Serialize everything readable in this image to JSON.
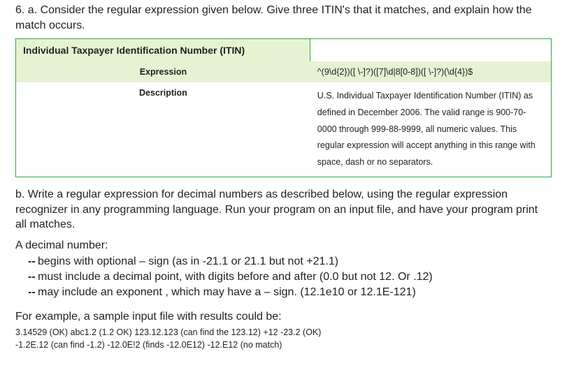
{
  "part_a": {
    "prompt": "6.  a.   Consider the regular expression given below.   Give three ITIN's that it matches, and explain how the match occurs.",
    "table_title": "Individual Taxpayer Identification Number (ITIN)",
    "expr_label": "Expression",
    "expr_value": "^(9\\d{2})([ \\-]?)([7]\\d|8[0-8])([ \\-]?)(\\d{4})$",
    "desc_label": "Description",
    "desc_value": "U.S. Individual Taxpayer Identification Number (ITIN) as defined in December 2006. The valid range is 900-70-0000 through 999-88-9999, all numeric values. This regular expression will accept anything in this range with space, dash or no separators."
  },
  "part_b": {
    "prompt": "b.   Write a regular expression for decimal numbers as described below, using the regular expression recognizer in any programming language.  Run your program on an input file, and have your program print all matches.",
    "lead": "A decimal number:",
    "bullets": [
      "begins with optional – sign  (as in -21.1 or 21.1 but not +21.1)",
      "must include a decimal point, with digits before and after (0.0 but not 12.  Or .12)",
      "may include an exponent , which may have a – sign.  (12.1e10 or 12.1E-121)"
    ],
    "example_lead": "For example, a sample input file with results could be:",
    "example_line1": "3.14529 (OK) abc1.2 (1.2 OK) 123.12.123 (can find the 123.12) +12 -23.2 (OK)",
    "example_line2": "-1.2E.12 (can find -1.2) -12.0E!2 (finds -12.0E12) -12.E12 (no match)"
  }
}
